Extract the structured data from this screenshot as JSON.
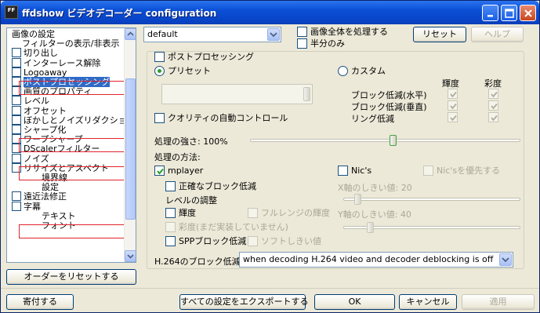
{
  "window": {
    "title": "ffdshow ビデオデコーダー configuration",
    "icon_text": "FF",
    "minimize_icon": "minimize-icon",
    "maximize_icon": "maximize-icon",
    "close_icon": "close-icon"
  },
  "tree": {
    "items": [
      {
        "label": "画像の設定",
        "check": false,
        "level": 0
      },
      {
        "label": "フィルターの表示/非表示",
        "check": false,
        "level": 1
      },
      {
        "label": "切り出し",
        "check": true,
        "level": 0
      },
      {
        "label": "インターレース解除",
        "check": true,
        "level": 0
      },
      {
        "label": "Logoaway",
        "check": true,
        "level": 0
      },
      {
        "label": "ポストプロセッシング",
        "check": true,
        "level": 0,
        "selected": true
      },
      {
        "label": "画質のプロパティ",
        "check": true,
        "level": 0
      },
      {
        "label": "レベル",
        "check": true,
        "level": 0
      },
      {
        "label": "オフセット",
        "check": true,
        "level": 0
      },
      {
        "label": "ぼかしとノイズリダクション",
        "check": true,
        "level": 0
      },
      {
        "label": "シャープ化",
        "check": true,
        "level": 0
      },
      {
        "label": "ワープシャープ",
        "check": true,
        "level": 0
      },
      {
        "label": "DScalerフィルター",
        "check": true,
        "level": 0
      },
      {
        "label": "ノイズ",
        "check": true,
        "level": 0
      },
      {
        "label": "リサイズとアスペクト",
        "check": true,
        "level": 0
      },
      {
        "label": "境界線",
        "check": false,
        "level": 2
      },
      {
        "label": "設定",
        "check": false,
        "level": 2
      },
      {
        "label": "遠近法修正",
        "check": true,
        "level": 0
      },
      {
        "label": "字幕",
        "check": true,
        "level": 0
      },
      {
        "label": "テキスト",
        "check": false,
        "level": 2
      },
      {
        "label": "フォント",
        "check": false,
        "level": 2
      }
    ],
    "reset_order_label": "オーダーをリセットする"
  },
  "top": {
    "preset": "default",
    "process_whole_image": "画像全体を処理する",
    "half_only": "半分のみ",
    "reset_label": "リセット",
    "help_label": "ヘルプ"
  },
  "postproc": {
    "title": "ポストプロセッシング",
    "preset_radio": "プリセット",
    "custom_radio": "カスタム",
    "luma_header": "輝度",
    "chroma_header": "彩度",
    "rows": [
      "ブロック低減(水平)",
      "ブロック低減(垂直)",
      "リング低減"
    ],
    "auto_quality": "クオリティの自動コントロール",
    "strength_label": "処理の強さ: 100%",
    "method_label": "処理の方法:",
    "strength_percent": 100,
    "mplayer": "mplayer",
    "nics": "Nic's",
    "nics_prefer": "Nic'sを優先する",
    "accurate_deblock": "正確なブロック低減",
    "level_adjust": "レベルの調整",
    "luma": "輝度",
    "full_range_luma": "フルレンジの輝度",
    "chroma_unimpl": "彩度(まだ実装していません)",
    "spp_deblock": "SPPブロック低減",
    "soft_threshold": "ソフトしきい値",
    "x_threshold": "X軸のしきい値: 20",
    "y_threshold": "Y軸のしきい値: 40",
    "h264_label": "H.264のブロック低減:",
    "h264_value": "when decoding H.264 video and decoder deblocking is off"
  },
  "bottom": {
    "donate": "寄付する",
    "export": "すべての設定をエクスポートする",
    "ok": "OK",
    "cancel": "キャンセル",
    "apply": "適用"
  }
}
